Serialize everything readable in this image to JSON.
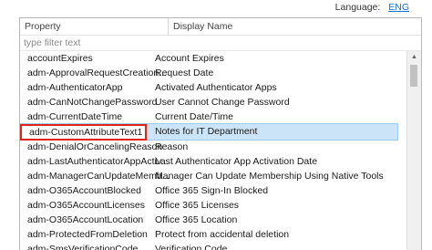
{
  "language": {
    "label": "Language:",
    "value": "ENG"
  },
  "grid": {
    "headers": {
      "property": "Property",
      "display_name": "Display Name"
    },
    "filter_placeholder": "type filter text",
    "rows": [
      {
        "property": "accountExpires",
        "display": "Account Expires"
      },
      {
        "property": "adm-ApprovalRequestCreation...",
        "display": "Request Date"
      },
      {
        "property": "adm-AuthenticatorApp",
        "display": "Activated Authenticator Apps"
      },
      {
        "property": "adm-CanNotChangePassword",
        "display": "User Cannot Change Password"
      },
      {
        "property": "adm-CurrentDateTime",
        "display": "Current Date/Time"
      },
      {
        "property": "adm-CustomAttributeText1",
        "display": "Notes for IT Department"
      },
      {
        "property": "adm-DenialOrCancelingReason",
        "display": "Reason"
      },
      {
        "property": "adm-LastAuthenticatorAppActiv...",
        "display": "Last Authenticator App Activation Date"
      },
      {
        "property": "adm-ManagerCanUpdateMemb...",
        "display": "Manager Can Update Membership Using Native Tools"
      },
      {
        "property": "adm-O365AccountBlocked",
        "display": "Office 365 Sign-In Blocked"
      },
      {
        "property": "adm-O365AccountLicenses",
        "display": "Office 365 Licenses"
      },
      {
        "property": "adm-O365AccountLocation",
        "display": "Office 365 Location"
      },
      {
        "property": "adm-ProtectedFromDeletion",
        "display": "Protect from accidental deletion"
      },
      {
        "property": "adm-SmsVerificationCode",
        "display": "Verification Code"
      }
    ],
    "selected_row_index": 5,
    "highlight_color": "#e2231a",
    "selection_color": "#cce4f7"
  }
}
